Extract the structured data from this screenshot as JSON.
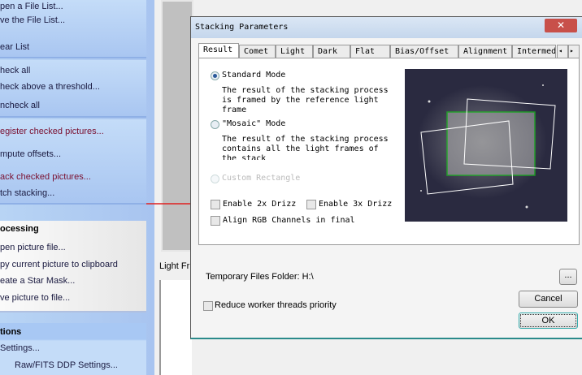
{
  "left_panel": {
    "file_items": [
      "pen a File List...",
      "ve the File List...",
      "ear List"
    ],
    "check_items": [
      "heck all",
      "heck above a threshold...",
      "ncheck all"
    ],
    "register_items": [
      "egister checked pictures...",
      "mpute offsets...",
      "ack checked pictures...",
      "tch stacking..."
    ],
    "processing_header": "ocessing",
    "processing_items": [
      "pen picture file...",
      "py current picture to clipboard",
      "eate a Star Mask...",
      "ve picture to file..."
    ],
    "options_header": "tions",
    "options_items": [
      "Settings...",
      "Raw/FITS DDP Settings..."
    ]
  },
  "light_frames_tab": "Light Fr",
  "dialog": {
    "title": "Stacking Parameters",
    "close": "✕",
    "tabs": [
      "Result",
      "Comet",
      "Light",
      "Dark",
      "Flat",
      "Bias/Offset",
      "Alignment",
      "Intermed"
    ],
    "scroll_left": "◂",
    "scroll_right": "▸",
    "standard_mode": "Standard Mode",
    "standard_desc": [
      "The result of the stacking process",
      "is framed by the reference light",
      "frame"
    ],
    "mosaic_mode": "\"Mosaic\" Mode",
    "mosaic_desc": [
      "The result of the stacking process",
      "contains all the light frames of",
      "the stack"
    ],
    "custom_rect": "Custom Rectangle",
    "drizzle2": "Enable 2x Drizz",
    "drizzle3": "Enable 3x Drizz",
    "align_rgb": "Align RGB Channels in final",
    "temp_folder": "Temporary Files Folder: H:\\",
    "browse": "...",
    "reduce_priority": "Reduce worker threads priority",
    "cancel": "Cancel",
    "ok": "OK"
  }
}
